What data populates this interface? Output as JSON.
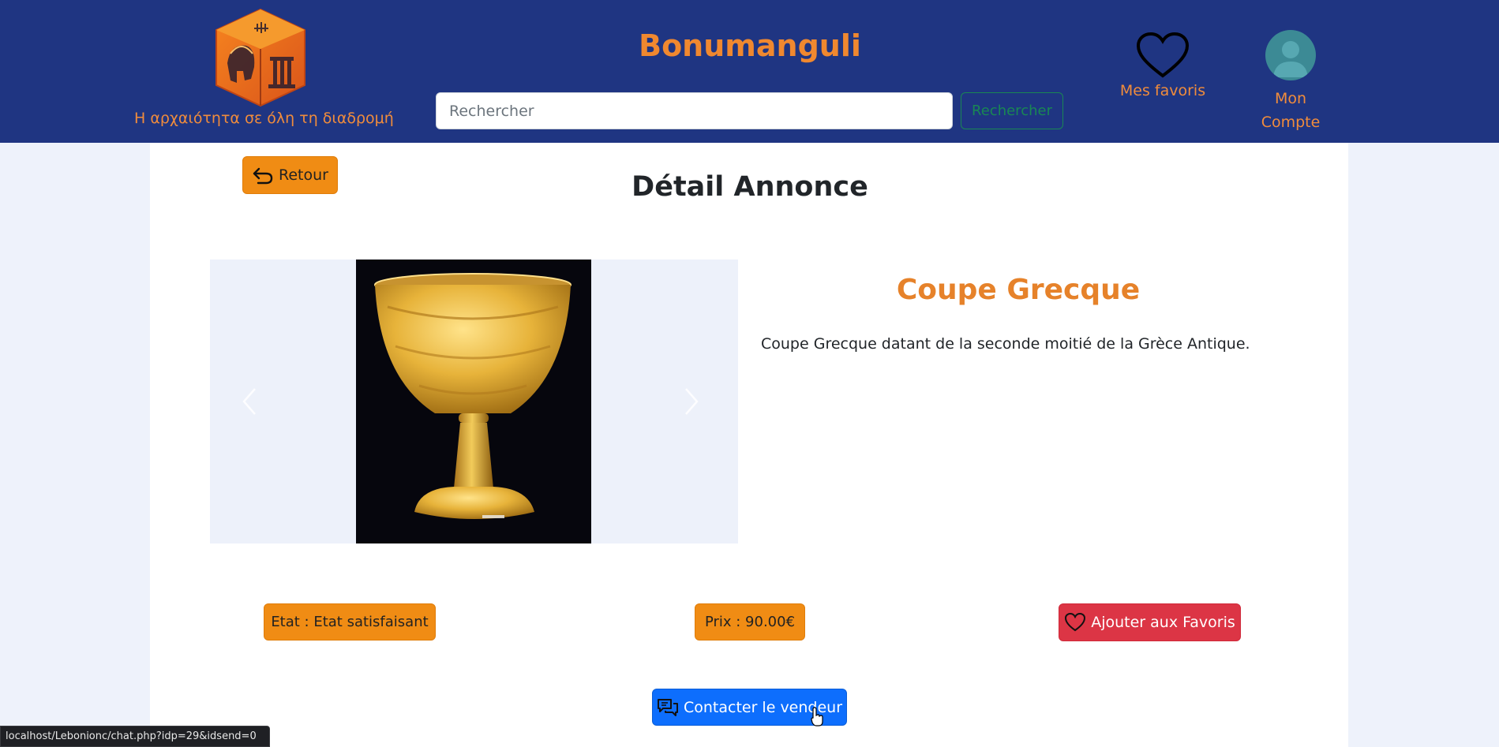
{
  "header": {
    "tagline": "Η αρχαιότητα σε όλη τη διαδρομή",
    "brand": "Bonumanguli",
    "search": {
      "placeholder": "Rechercher",
      "value": "",
      "button_label": "Rechercher"
    },
    "favorites_label": "Mes favoris",
    "account_label_line1": "Mon",
    "account_label_line2": "Compte",
    "icons": {
      "logo": "helmet-column-cube-logo",
      "favorites": "heart-icon",
      "account": "user-avatar-icon"
    }
  },
  "main": {
    "back_button_label": "Retour",
    "page_title": "Détail Annonce",
    "product": {
      "title": "Coupe Grecque",
      "description": "Coupe Grecque datant de la seconde moitié de la Grèce Antique.",
      "state_label": "Etat : Etat satisfaisant",
      "price_label": "Prix : 90.00€"
    },
    "favorite_button_label": "Ajouter aux Favoris",
    "contact_button_label": "Contacter le vendeur"
  },
  "status_bar": {
    "url": "localhost/Lebonionc/chat.php?idp=29&idsend=0"
  },
  "colors": {
    "header_bg": "#1f3582",
    "accent_orange": "#f08c14",
    "brand_orange": "#f0882f",
    "danger": "#dc3545",
    "primary": "#0d6efd",
    "success": "#198754",
    "page_bg": "#eef2fb"
  }
}
